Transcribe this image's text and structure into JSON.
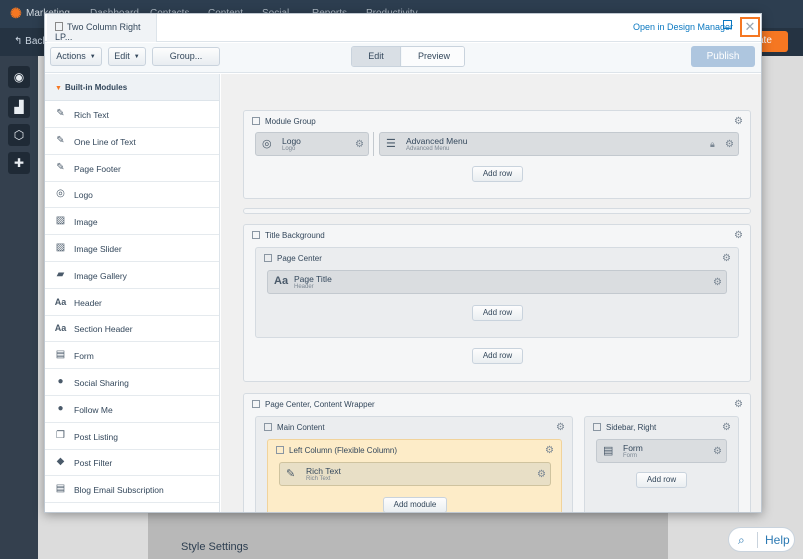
{
  "background": {
    "brand": "Marketing",
    "nav": [
      "Dashboard",
      "Contacts",
      "Content",
      "Social",
      "Reports",
      "Productivity"
    ],
    "back_label": "Back",
    "publish_peek": "ate",
    "style_settings": "Style Settings",
    "help": "Help"
  },
  "modal": {
    "tab_title": "Two Column Right LP...",
    "open_design_manager": "Open in Design Manager",
    "close_symbol": "✕",
    "toolbar": {
      "actions": "Actions",
      "edit": "Edit",
      "group": "Group...",
      "mode_edit": "Edit",
      "mode_preview": "Preview",
      "publish": "Publish"
    },
    "sidebar": {
      "header": "Built-in Modules",
      "items": [
        {
          "label": "Rich Text",
          "icon": "edit-icon"
        },
        {
          "label": "One Line of Text",
          "icon": "edit-icon"
        },
        {
          "label": "Page Footer",
          "icon": "edit-icon"
        },
        {
          "label": "Logo",
          "icon": "globe-icon"
        },
        {
          "label": "Image",
          "icon": "image-icon"
        },
        {
          "label": "Image Slider",
          "icon": "image-icon"
        },
        {
          "label": "Image Gallery",
          "icon": "folder-icon"
        },
        {
          "label": "Header",
          "icon": "text-aa-icon"
        },
        {
          "label": "Section Header",
          "icon": "text-aa-icon"
        },
        {
          "label": "Form",
          "icon": "form-icon"
        },
        {
          "label": "Social Sharing",
          "icon": "speech-bubble-icon"
        },
        {
          "label": "Follow Me",
          "icon": "speech-bubble-icon"
        },
        {
          "label": "Post Listing",
          "icon": "list-icon"
        },
        {
          "label": "Post Filter",
          "icon": "tag-icon"
        },
        {
          "label": "Blog Email Subscription",
          "icon": "form-icon"
        }
      ]
    },
    "canvas": {
      "module_group": {
        "title": "Module Group",
        "logo": {
          "title": "Logo",
          "sub": "Logo"
        },
        "menu": {
          "title": "Advanced Menu",
          "sub": "Advanced Menu"
        },
        "add_row": "Add row"
      },
      "title_background": {
        "title": "Title Background",
        "page_center": {
          "title": "Page Center",
          "page_title": {
            "title": "Page Title",
            "sub": "Header"
          },
          "add_row": "Add row"
        },
        "add_row": "Add row"
      },
      "content_wrapper": {
        "title": "Page Center, Content Wrapper",
        "main_content": {
          "title": "Main Content",
          "left_column": {
            "title": "Left Column (Flexible Column)",
            "rich_text": {
              "title": "Rich Text",
              "sub": "Rich Text"
            },
            "add_module": "Add module"
          }
        },
        "sidebar_right": {
          "title": "Sidebar, Right",
          "form": {
            "title": "Form",
            "sub": "Form"
          },
          "add_row": "Add row"
        }
      }
    }
  },
  "colors": {
    "accent": "#f57722",
    "link": "#0a78c1",
    "publish_disabled": "#aec6df",
    "highlight": "#fdecc8"
  }
}
